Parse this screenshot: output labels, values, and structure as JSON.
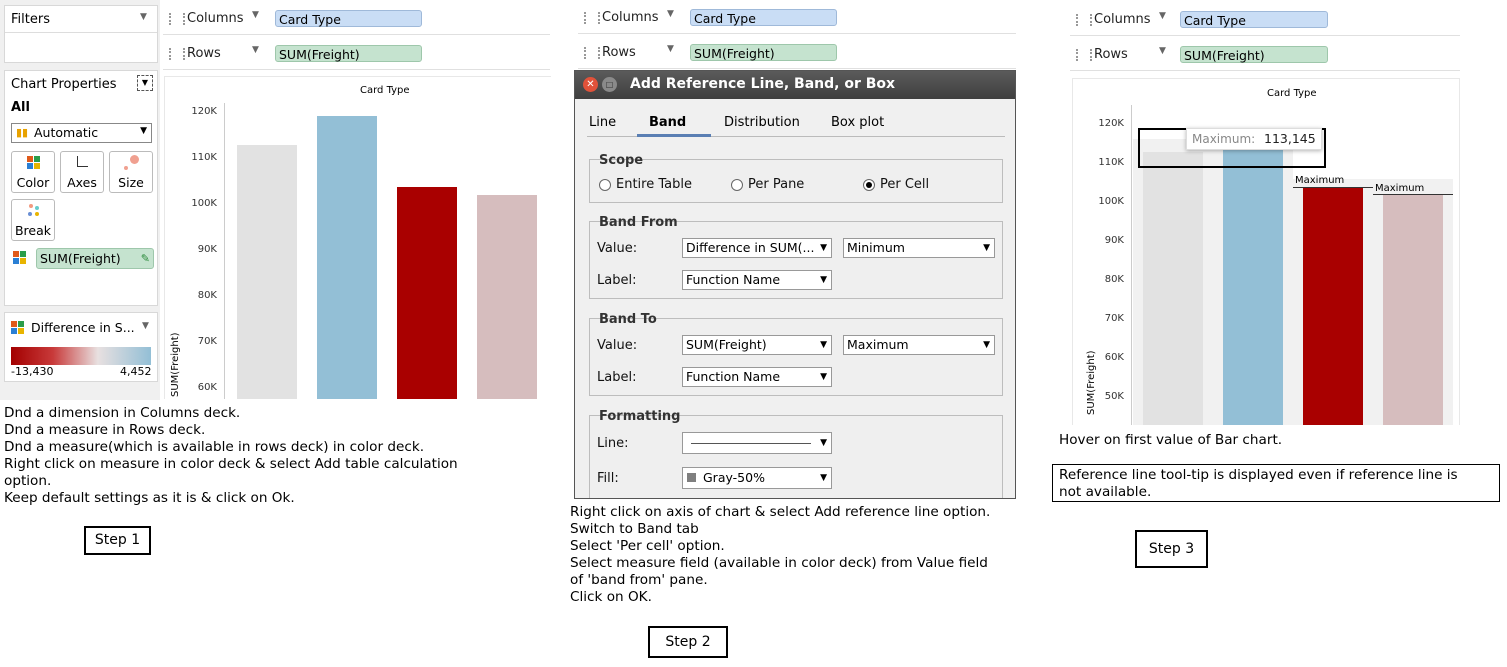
{
  "step1": {
    "filters_title": "Filters",
    "columns_label": "Columns",
    "columns_pill": "Card Type",
    "rows_label": "Rows",
    "rows_pill": "SUM(Freight)",
    "chart_props_title": "Chart Properties",
    "all_label": "All",
    "mark_type": "Automatic",
    "buttons": [
      "Color",
      "Axes",
      "Size",
      "Break"
    ],
    "color_pill": "SUM(Freight)",
    "legend_title": "Difference in S...",
    "legend_min": "-13,430",
    "legend_max": "4,452",
    "instructions": [
      "Dnd a dimension in Columns deck.",
      "Dnd a measure in Rows deck.",
      "Dnd a measure(which is available in rows deck) in color deck.",
      "Right click on measure in color deck & select Add table calculation",
      "option.",
      "Keep default settings as it is & click on Ok."
    ],
    "step_label": "Step 1"
  },
  "step2": {
    "columns_label": "Columns",
    "columns_pill": "Card Type",
    "rows_label": "Rows",
    "rows_pill": "SUM(Freight)",
    "dialog_title": "Add Reference Line, Band, or Box",
    "tabs": [
      "Line",
      "Band",
      "Distribution",
      "Box plot"
    ],
    "active_tab": "Band",
    "scope_title": "Scope",
    "scope_options": [
      "Entire Table",
      "Per Pane",
      "Per Cell"
    ],
    "scope_selected": "Per Cell",
    "band_from_title": "Band From",
    "band_to_title": "Band To",
    "value_label": "Value:",
    "label_label": "Label:",
    "band_from_value": "Difference in SUM(...",
    "band_from_agg": "Minimum",
    "band_from_label": "Function Name",
    "band_to_value": "SUM(Freight)",
    "band_to_agg": "Maximum",
    "band_to_label": "Function Name",
    "formatting_title": "Formatting",
    "line_label": "Line:",
    "fill_label": "Fill:",
    "fill_value": "Gray-50%",
    "instructions": [
      "Right click on axis of chart & select Add reference line option.",
      "Switch to Band tab",
      "Select 'Per cell' option.",
      "Select measure field (available in color deck) from Value field",
      "of 'band from' pane.",
      "Click on OK."
    ],
    "step_label": "Step 2"
  },
  "step3": {
    "columns_label": "Columns",
    "columns_pill": "Card Type",
    "rows_label": "Rows",
    "rows_pill": "SUM(Freight)",
    "tooltip_label": "Maximum:",
    "tooltip_value": "113,145",
    "ref_label": "Maximum",
    "ref_label_partial": "Maxim",
    "instruction1": "Hover on first value of Bar chart.",
    "observation": [
      "Reference line tool-tip is displayed even if reference line is",
      "not available."
    ],
    "step_label": "Step 3"
  },
  "chart_data": [
    {
      "type": "bar",
      "title": "Card Type",
      "ylabel": "SUM(Freight)",
      "yticks": [
        "120K",
        "110K",
        "100K",
        "90K",
        "80K",
        "70K",
        "60K"
      ],
      "ylim_visible": [
        56500,
        120000
      ],
      "values": [
        113100,
        119300,
        104000,
        102200
      ],
      "colors": [
        "#e2e2e2",
        "#93bfd6",
        "#a90000",
        "#d6bdbe"
      ]
    },
    {
      "type": "bar",
      "title": "Card Type",
      "ylabel": "SUM(Freight)",
      "yticks": [
        "120K",
        "110K",
        "100K",
        "90K",
        "80K",
        "70K",
        "60K",
        "50K"
      ],
      "ylim_visible": [
        43000,
        120000
      ],
      "values": [
        113145,
        119300,
        104000,
        102200
      ],
      "colors": [
        "#e2e2e2",
        "#93bfd6",
        "#a90000",
        "#d6bdbe"
      ]
    }
  ]
}
